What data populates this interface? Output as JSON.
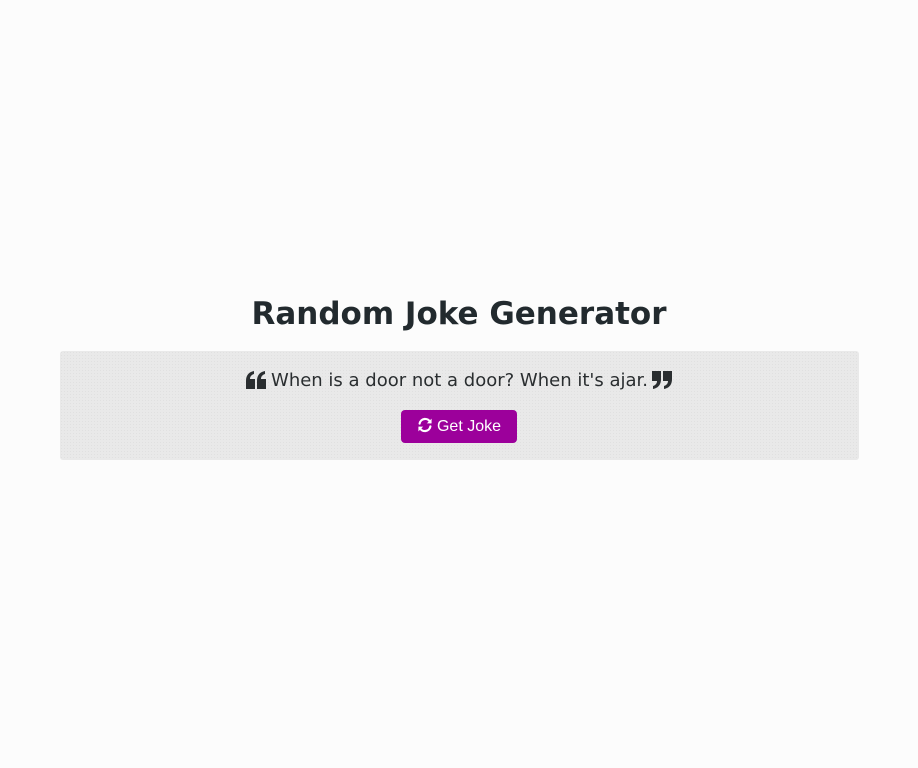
{
  "page": {
    "title": "Random Joke Generator"
  },
  "joke": {
    "text": "When is a door not a door? When it's ajar.",
    "open_quote_icon": "quote-left-icon",
    "close_quote_icon": "quote-right-icon"
  },
  "button": {
    "label": "Get Joke",
    "icon": "refresh-icon"
  },
  "colors": {
    "accent": "#9c009b",
    "card_background": "#e9e9e9",
    "page_background": "#fcfcfc",
    "title_text": "#222a2e"
  }
}
